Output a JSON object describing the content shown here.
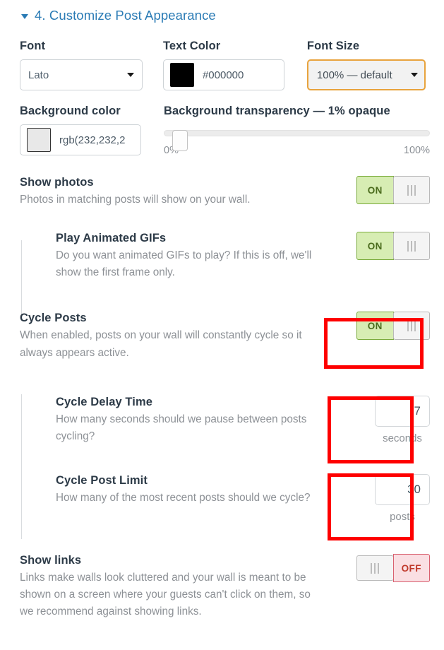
{
  "section": {
    "title": "4. Customize Post Appearance",
    "caret_icon": "caret-down-icon",
    "accent_color": "#2a7bb5"
  },
  "appearance": {
    "font": {
      "label": "Font",
      "value": "Lato",
      "caret_icon": "chevron-down-icon"
    },
    "text_color": {
      "label": "Text Color",
      "value": "#000000",
      "swatch_color": "#000000"
    },
    "font_size": {
      "label": "Font Size",
      "value": "100% — default",
      "caret_icon": "chevron-down-icon",
      "border_color": "#e8a33d"
    },
    "background_color": {
      "label": "Background color",
      "value": "rgb(232,232,2",
      "swatch_color": "#e8e8e8"
    },
    "background_transparency": {
      "label": "Background transparency — 1% opaque",
      "min_label": "0%",
      "max_label": "100%",
      "value_percent": 1
    }
  },
  "options": [
    {
      "title": "Show photos",
      "desc": "Photos in matching posts will show on your wall.",
      "toggle_state": "ON",
      "indented": false,
      "highlighted": false
    },
    {
      "title": "Play Animated GIFs",
      "desc": "Do you want animated GIFs to play? If this is off, we'll show the first frame only.",
      "toggle_state": "ON",
      "indented": true,
      "highlighted": false
    },
    {
      "title": "Cycle Posts",
      "desc": "When enabled, posts on your wall will constantly cycle so it always appears active.",
      "toggle_state": "ON",
      "indented": false,
      "highlighted": true
    },
    {
      "title": "Show links",
      "desc": "Links make walls look cluttered and your wall is meant to be shown on a screen where your guests can't click on them, so we recommend against showing links.",
      "toggle_state": "OFF",
      "indented": false,
      "highlighted": false
    }
  ],
  "numeric_options": [
    {
      "title": "Cycle Delay Time",
      "desc": "How many seconds should we pause between posts cycling?",
      "value": "7",
      "unit": "seconds",
      "highlighted": true
    },
    {
      "title": "Cycle Post Limit",
      "desc": "How many of the most recent posts should we cycle?",
      "value": "30",
      "unit": "posts",
      "highlighted": true
    }
  ],
  "toggle_labels": {
    "on": "ON",
    "off": "OFF"
  },
  "highlight_color": "#fe0000"
}
